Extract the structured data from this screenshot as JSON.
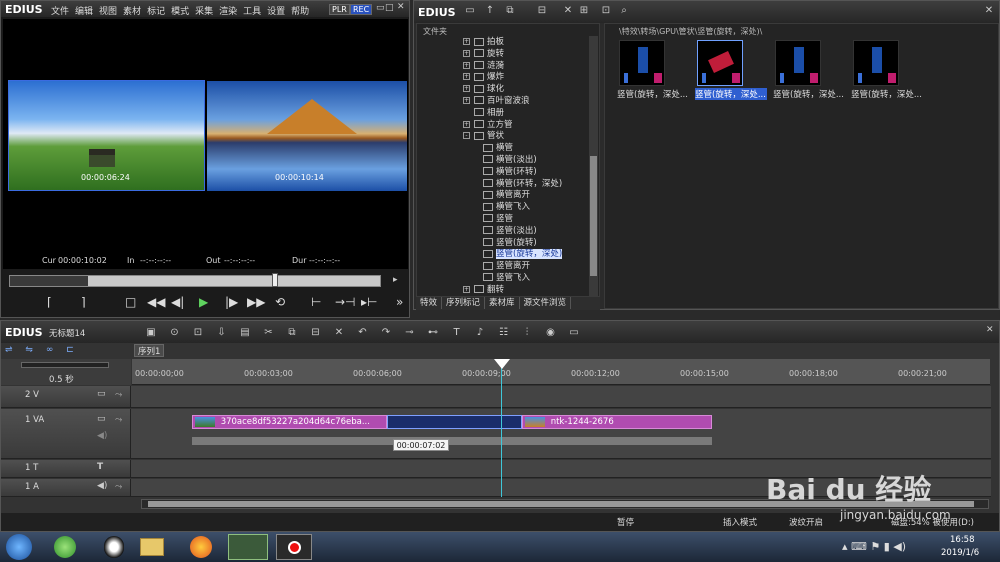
{
  "player": {
    "logo": "EDIUS",
    "menu": [
      "文件",
      "编辑",
      "视图",
      "素材",
      "标记",
      "模式",
      "采集",
      "渲染",
      "工具",
      "设置",
      "帮助"
    ],
    "plr": "PLR",
    "rec": "REC",
    "left_timecode": "00:00:06:24",
    "right_timecode": "00:00:10:14",
    "cur_label": "Cur",
    "cur_value": "00:00:10:02",
    "in_label": "In",
    "in_value": "--:--:--:--",
    "out_label": "Out",
    "out_value": "--:--:--:--",
    "dur_label": "Dur",
    "dur_value": "--:--:--:--"
  },
  "library": {
    "logo": "EDIUS",
    "folder_header": "文件夹",
    "path": "\\特效\\转场\\GPU\\管状\\竖管(旋转，深处)\\",
    "tree": [
      {
        "label": "拍板",
        "expand": "+",
        "indent": 1
      },
      {
        "label": "旋转",
        "expand": "+",
        "indent": 1
      },
      {
        "label": "涟漪",
        "expand": "+",
        "indent": 1
      },
      {
        "label": "爆炸",
        "expand": "+",
        "indent": 1
      },
      {
        "label": "球化",
        "expand": "+",
        "indent": 1
      },
      {
        "label": "百叶窗波浪",
        "expand": "+",
        "indent": 1
      },
      {
        "label": "相册",
        "expand": "",
        "indent": 1
      },
      {
        "label": "立方管",
        "expand": "+",
        "indent": 1
      },
      {
        "label": "管状",
        "expand": "-",
        "indent": 1
      },
      {
        "label": "横管",
        "expand": "",
        "indent": 2
      },
      {
        "label": "横管(淡出)",
        "expand": "",
        "indent": 2
      },
      {
        "label": "横管(环转)",
        "expand": "",
        "indent": 2
      },
      {
        "label": "横管(环转，深处)",
        "expand": "",
        "indent": 2
      },
      {
        "label": "横管离开",
        "expand": "",
        "indent": 2
      },
      {
        "label": "横管飞入",
        "expand": "",
        "indent": 2
      },
      {
        "label": "竖管",
        "expand": "",
        "indent": 2
      },
      {
        "label": "竖管(淡出)",
        "expand": "",
        "indent": 2
      },
      {
        "label": "竖管(旋转)",
        "expand": "",
        "indent": 2
      },
      {
        "label": "竖管(旋转，深处)",
        "expand": "",
        "indent": 2,
        "selected": true
      },
      {
        "label": "竖管离开",
        "expand": "",
        "indent": 2
      },
      {
        "label": "竖管飞入",
        "expand": "",
        "indent": 2
      },
      {
        "label": "翻转",
        "expand": "+",
        "indent": 1
      }
    ],
    "tabs": [
      "特效",
      "序列标记",
      "素材库",
      "源文件浏览"
    ],
    "items": [
      {
        "label": "竖管(旋转，深处..."
      },
      {
        "label": "竖管(旋转，深处..."
      },
      {
        "label": "竖管(旋转，深处..."
      },
      {
        "label": "竖管(旋转，深处..."
      }
    ]
  },
  "timeline": {
    "logo": "EDIUS",
    "project_name": "无标题14",
    "sequence_tab": "序列1",
    "zoom_label": "0.5 秒",
    "ruler": [
      "00:00:00;00",
      "00:00:03;00",
      "00:00:06;00",
      "00:00:09;00",
      "00:00:12;00",
      "00:00:15;00",
      "00:00:18;00",
      "00:00:21;00"
    ],
    "tracks": [
      {
        "name": "2 V"
      },
      {
        "name": "1 VA"
      },
      {
        "name": "1 T"
      },
      {
        "name": "1 A"
      }
    ],
    "clip1": "370ace8df53227a204d64c76eba...",
    "clip2": "ntk-1244-2676",
    "tooltip": "00:00:07:02"
  },
  "statusbar": {
    "pause": "暂停",
    "insert_mode": "插入模式",
    "ripple": "波纹开启",
    "disk": "磁盘:54% 被使用(D:)"
  },
  "taskbar": {
    "time": "16:58",
    "date": "2019/1/6"
  },
  "watermark": {
    "text": "Bai du 经验",
    "url": "jingyan.baidu.com"
  }
}
